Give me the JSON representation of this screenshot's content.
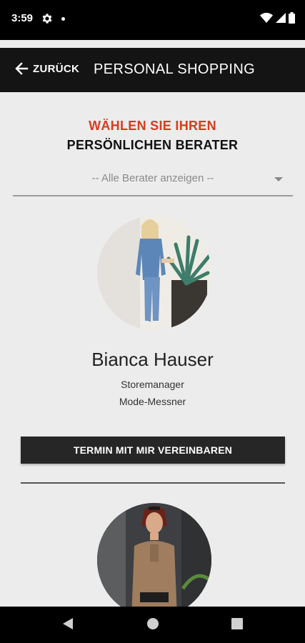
{
  "status_bar": {
    "time": "3:59",
    "icons": [
      "gear-icon",
      "notification-dot",
      "wifi-icon",
      "signal-icon",
      "battery-icon"
    ]
  },
  "app_bar": {
    "back_label": "ZURÜCK",
    "title": "PERSONAL SHOPPING"
  },
  "main": {
    "heading_line1": "WÄHLEN SIE IHREN",
    "heading_line2": "PERSÖNLICHEN BERATER",
    "filter": {
      "selected": "-- Alle Berater anzeigen --"
    },
    "consultants": [
      {
        "name": "Bianca Hauser",
        "role": "Storemanager",
        "store": "Mode-Messner",
        "cta_label": "TERMIN MIT MIR VEREINBAREN"
      }
    ]
  },
  "colors": {
    "accent_red": "#d63c1f",
    "app_bar": "#141414",
    "background": "#ececec",
    "button": "#262626"
  },
  "nav_bar": {
    "icons": [
      "back-triangle-icon",
      "home-circle-icon",
      "recents-square-icon"
    ]
  }
}
